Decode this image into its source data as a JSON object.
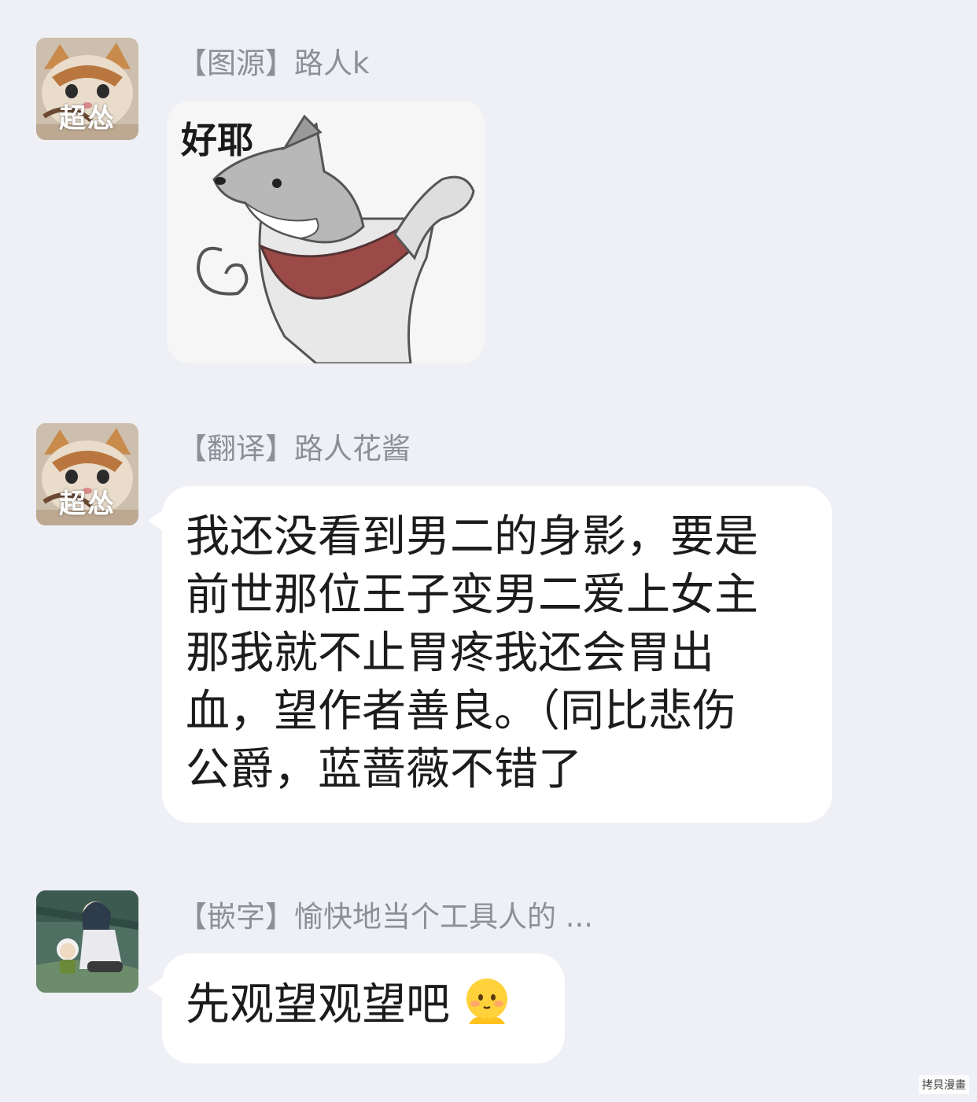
{
  "messages": [
    {
      "avatar_label": "超怂",
      "sender": "【图源】路人k",
      "sticker_caption": "好耶",
      "sticker_icon": "dancing-shiba-dog-sticker"
    },
    {
      "avatar_label": "超怂",
      "sender": "【翻译】路人花酱",
      "lines": [
        "我还没看到男二的身影，要是",
        "前世那位王子变男二爱上女主",
        "那我就不止胃疼我还会胃出",
        "血，望作者善良。（同比悲伤",
        "公爵，蓝蔷薇不错了"
      ]
    },
    {
      "avatar_label": "",
      "sender": "【嵌字】愉快地当个工具人的 ...",
      "text": "先观望观望吧",
      "emoji": "shy-smile-emoji"
    }
  ],
  "watermark": "拷貝漫畫"
}
